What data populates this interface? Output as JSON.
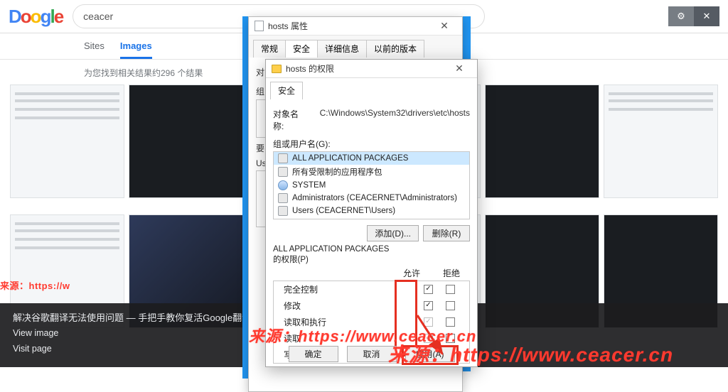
{
  "header": {
    "logo_text": "Doogle",
    "search_value": "ceacer"
  },
  "tabs": {
    "sites": "Sites",
    "images": "Images"
  },
  "result_count": "为您找到相关结果约296 个结果",
  "caption": {
    "title": "解决谷歌翻译无法使用问题 — 手把手教你复活Google翻译-Ceacer 网安",
    "view_image": "View image",
    "visit_page": "Visit page"
  },
  "watermarks": {
    "bg_left": "来源：https://w",
    "mid": "来源：https://www.ceacer.cn",
    "big": "来源：https://www.ceacer.cn"
  },
  "dlg_outer": {
    "title": "hosts 属性",
    "tabs": [
      "常规",
      "安全",
      "详细信息",
      "以前的版本"
    ],
    "obj_label": "对象",
    "group_label": "组",
    "edit_label": "要",
    "users_label": "Us"
  },
  "dlg_inner": {
    "title": "hosts 的权限",
    "tab": "安全",
    "obj_label": "对象名称:",
    "obj_value": "C:\\Windows\\System32\\drivers\\etc\\hosts",
    "group_label": "组或用户名(G):",
    "groups": [
      "ALL APPLICATION PACKAGES",
      "所有受限制的应用程序包",
      "SYSTEM",
      "Administrators (CEACERNET\\Administrators)",
      "Users (CEACERNET\\Users)"
    ],
    "btn_add": "添加(D)...",
    "btn_remove": "删除(R)",
    "perm_head_1": "ALL APPLICATION PACKAGES",
    "perm_head_2": "的权限(P)",
    "col_allow": "允许",
    "col_deny": "拒绝",
    "perms": [
      {
        "name": "完全控制",
        "allow": true,
        "allow_dim": false,
        "deny": false
      },
      {
        "name": "修改",
        "allow": true,
        "allow_dim": false,
        "deny": false
      },
      {
        "name": "读取和执行",
        "allow": true,
        "allow_dim": true,
        "deny": false
      },
      {
        "name": "读取",
        "allow": true,
        "allow_dim": true,
        "deny": false
      },
      {
        "name": "写入",
        "allow": false,
        "allow_dim": false,
        "deny": false
      }
    ],
    "footer_ok": "确定",
    "footer_cancel": "取消",
    "footer_apply": "应用(A)"
  }
}
